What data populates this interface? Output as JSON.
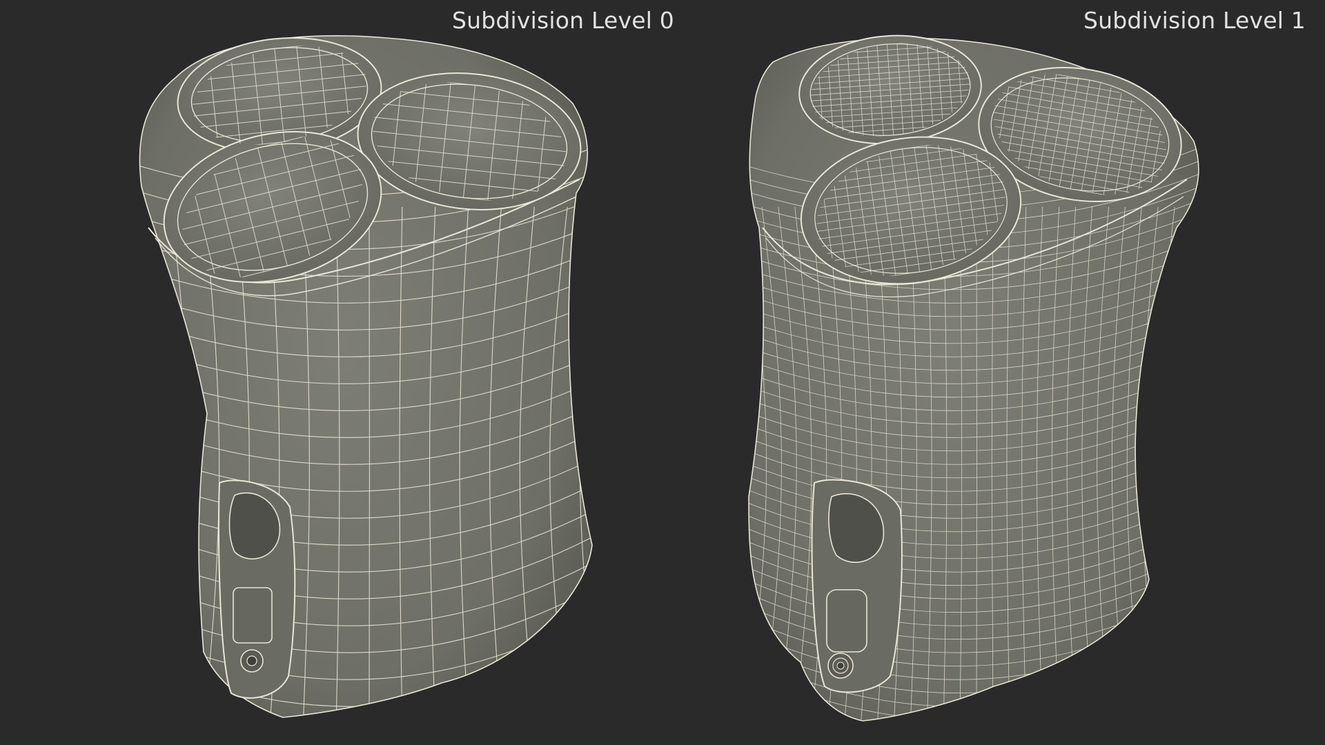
{
  "labels": {
    "left": "Subdivision Level 0",
    "right": "Subdivision Level 1"
  },
  "colors": {
    "background": "#2a2a2a",
    "surface": "#72736a",
    "wire": "#e8e6d4",
    "label": "#e2e2e2"
  },
  "models": {
    "left": {
      "wire_density": 1
    },
    "right": {
      "wire_density": 2
    }
  }
}
